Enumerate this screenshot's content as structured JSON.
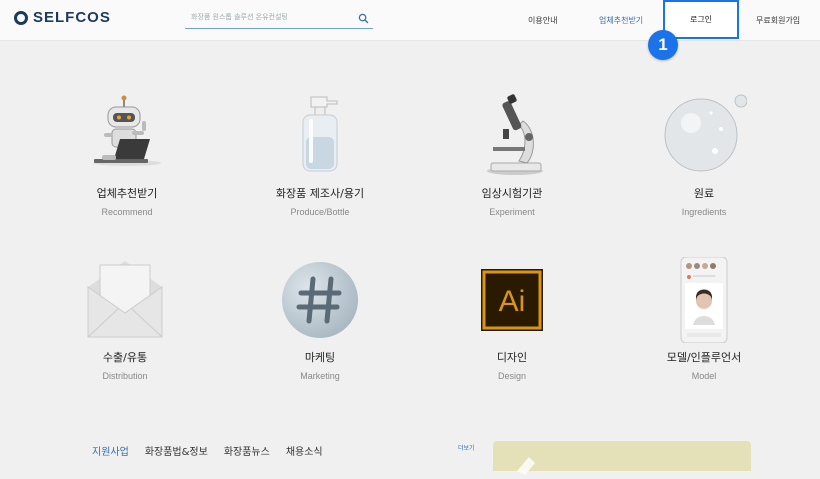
{
  "header": {
    "logo_text": "SELFCOS",
    "search_placeholder": "화장품 원스톱 솔루션 온유컨설팅",
    "nav": {
      "guide": "이용안내",
      "recommend": "업체추천받기",
      "login": "로그인",
      "signup": "무료회원가입"
    }
  },
  "step_marker": "1",
  "categories": [
    {
      "title": "업체추천받기",
      "subtitle": "Recommend",
      "icon": "robot-laptop-icon"
    },
    {
      "title": "화장품 제조사/용기",
      "subtitle": "Produce/Bottle",
      "icon": "pump-bottle-icon"
    },
    {
      "title": "임상시험기관",
      "subtitle": "Experiment",
      "icon": "microscope-icon"
    },
    {
      "title": "원료",
      "subtitle": "Ingredients",
      "icon": "bubble-icon"
    },
    {
      "title": "수출/유통",
      "subtitle": "Distribution",
      "icon": "envelope-icon"
    },
    {
      "title": "마케팅",
      "subtitle": "Marketing",
      "icon": "hashtag-icon"
    },
    {
      "title": "디자인",
      "subtitle": "Design",
      "icon": "illustrator-icon"
    },
    {
      "title": "모델/인플루언서",
      "subtitle": "Model",
      "icon": "phone-profile-icon"
    }
  ],
  "bottom": {
    "tabs": [
      "지원사업",
      "화장품법&정보",
      "화장품뉴스",
      "채용소식"
    ],
    "more": "더보기"
  },
  "colors": {
    "accent": "#1a73e8",
    "brand": "#1b3a5c",
    "active_link": "#3a6eb0"
  }
}
